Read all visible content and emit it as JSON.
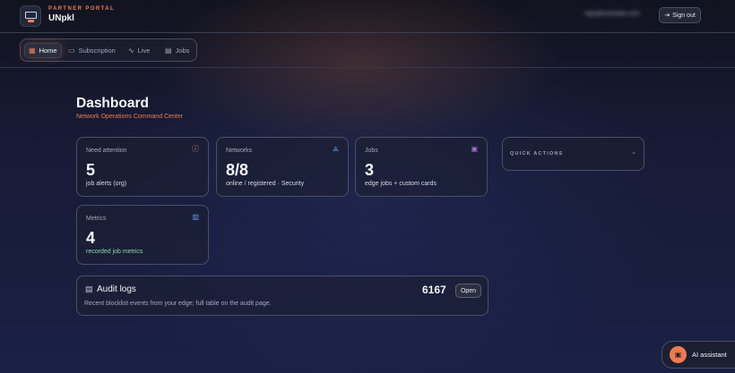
{
  "header": {
    "kicker": "PARTNER PORTAL",
    "brand": "UNpkl",
    "user_email": "sign@example.com",
    "signout_label": "Sign out"
  },
  "nav": {
    "items": [
      {
        "label": "Home",
        "icon": "grid-icon",
        "active": true
      },
      {
        "label": "Subscription",
        "icon": "card-icon",
        "active": false
      },
      {
        "label": "Live",
        "icon": "activity-icon",
        "active": false
      },
      {
        "label": "Jobs",
        "icon": "briefcase-icon",
        "active": false
      }
    ]
  },
  "page": {
    "title": "Dashboard",
    "subtitle": "Network Operations Command Center"
  },
  "cards": {
    "attention": {
      "label": "Need attention",
      "value": "5",
      "desc": "job alerts (org)",
      "icon": "alert-circle-icon",
      "icon_color": "#f0a04e"
    },
    "networks": {
      "label": "Networks",
      "value": "8/8",
      "desc": "online / registered · Security",
      "icon": "network-icon",
      "icon_color": "#5b9cf0"
    },
    "jobs": {
      "label": "Jobs",
      "value": "3",
      "desc": "edge jobs + custom cards",
      "icon": "clipboard-icon",
      "icon_color": "#b06ad8"
    },
    "metrics": {
      "label": "Metrics",
      "value": "4",
      "desc": "recorded job metrics",
      "icon": "chart-icon",
      "icon_color": "#5b9cf0",
      "desc_color": "#8fd6b0"
    }
  },
  "quick_actions": {
    "label": "QUICK ACTIONS"
  },
  "audit": {
    "title": "Audit logs",
    "desc": "Recent blocklist events from your edge; full table on the audit page.",
    "count": "6167",
    "open_label": "Open"
  },
  "assistant": {
    "label": "AI assistant"
  },
  "colors": {
    "accent": "#f07a4e"
  }
}
